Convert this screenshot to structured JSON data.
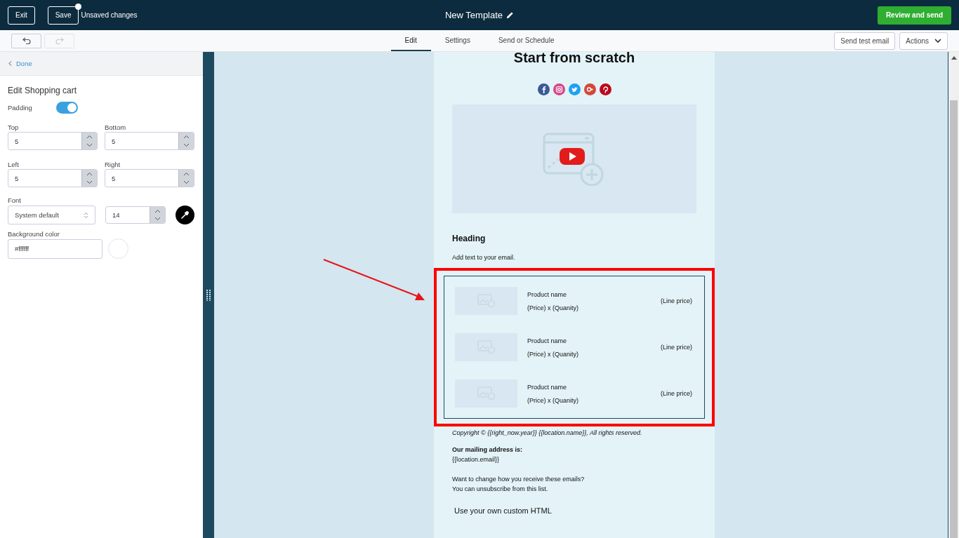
{
  "topbar": {
    "buttons": [
      {
        "label": "Exit",
        "unsaved": false
      },
      {
        "label": "Save",
        "unsaved": true
      }
    ],
    "status": "Unsaved changes",
    "title": "New Template",
    "primary_button": "Review and send"
  },
  "toolbar": {
    "history": [
      {
        "kind": "undo",
        "disabled": false
      },
      {
        "kind": "redo",
        "disabled": true
      }
    ],
    "tabs": [
      {
        "label": "Edit",
        "selected": true
      },
      {
        "label": "Settings",
        "selected": false
      },
      {
        "label": "Send or Schedule",
        "selected": false
      }
    ],
    "buttons": [
      "Send test email"
    ],
    "actions": "Actions"
  },
  "sidebar": {
    "back": "Done",
    "title": "Edit Shopping cart",
    "padding": {
      "label": "Padding",
      "on": true
    },
    "fields": [
      {
        "label": "Top",
        "value": "5"
      },
      {
        "label": "Bottom",
        "value": "5"
      },
      {
        "label": "Left",
        "value": "5"
      },
      {
        "label": "Right",
        "value": "5"
      }
    ],
    "font": {
      "label": "Font",
      "family": "System default",
      "size": "14"
    },
    "background": {
      "label": "Background color",
      "value": "#ffffff"
    }
  },
  "email": {
    "title": "Start from scratch",
    "social": [
      {
        "kind": "facebook",
        "color": "#3b5998"
      },
      {
        "kind": "instagram",
        "color": "#d6478a"
      },
      {
        "kind": "twitter",
        "color": "#1da1f2"
      },
      {
        "kind": "google-plus",
        "color": "#d34836"
      },
      {
        "kind": "pinterest",
        "color": "#bd081c"
      }
    ],
    "heading": "Heading",
    "text": "Add text to your email.",
    "cart": {
      "selected": true,
      "items": [
        {
          "name": "Product name",
          "price_qty": "(Price) x (Quanity)",
          "line_price": "(Line price)"
        },
        {
          "name": "Product name",
          "price_qty": "(Price) x (Quanity)",
          "line_price": "(Line price)"
        },
        {
          "name": "Product name",
          "price_qty": "(Price) x (Quanity)",
          "line_price": "(Line price)"
        }
      ]
    },
    "copyright": "Copyright © {{right_now.year}}  {{location.name}}, All rights reserved.",
    "mailing_label": "Our mailing address is:",
    "mailing_value": "{{location.email}}",
    "change_lines": [
      "Want to change how you receive these emails?",
      "You can unsubscribe from this list."
    ],
    "custom_html": "Use your own custom HTML"
  }
}
